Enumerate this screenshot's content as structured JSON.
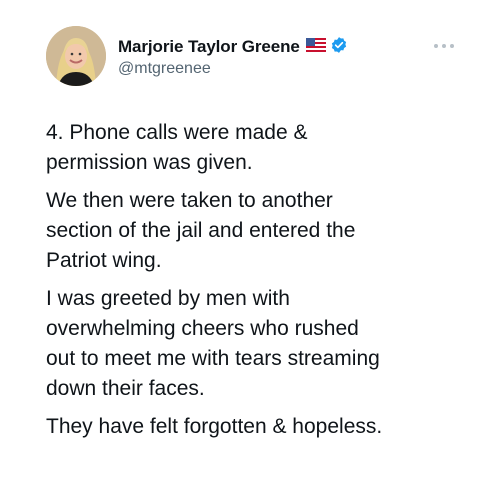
{
  "author": {
    "name": "Marjorie Taylor Greene",
    "handle": "@mtgreenee",
    "flag_icon": "us-flag-icon",
    "verified_icon": "verified-badge-icon",
    "verified_color": "#1d9bf0"
  },
  "menu": {
    "icon": "more-icon"
  },
  "tweet": {
    "paragraphs": [
      "4. Phone calls were made &\npermission was given.",
      "We then were taken to another\nsection of the jail and entered the\nPatriot wing.",
      "I was greeted by men with\noverwhelming cheers who rushed\nout to meet me with tears streaming\ndown their faces.",
      "They have felt forgotten & hopeless."
    ]
  }
}
